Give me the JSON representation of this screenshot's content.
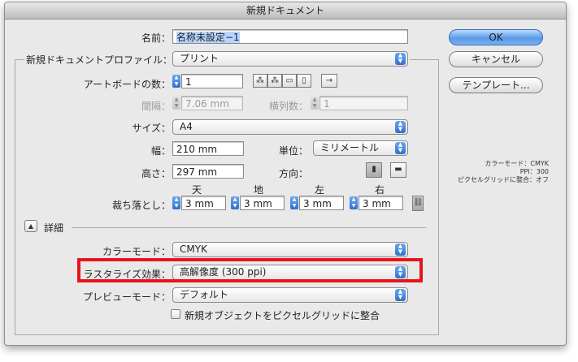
{
  "window": {
    "title": "新規ドキュメント"
  },
  "name": {
    "label": "名前：",
    "value": "名称未設定−1"
  },
  "profile": {
    "label": "新規ドキュメントプロファイル：",
    "value": "プリント"
  },
  "artboards": {
    "label": "アートボードの数：",
    "value": "1"
  },
  "spacing": {
    "label": "間隔：",
    "value": "7.06 mm"
  },
  "columns": {
    "label": "横列数：",
    "value": "1"
  },
  "size": {
    "label": "サイズ：",
    "value": "A4"
  },
  "width": {
    "label": "幅：",
    "value": "210 mm"
  },
  "units": {
    "label": "単位：",
    "value": "ミリメートル"
  },
  "height": {
    "label": "高さ：",
    "value": "297 mm"
  },
  "orientation": {
    "label": "方向："
  },
  "bleed": {
    "label": "裁ち落とし：",
    "top": {
      "label": "天",
      "value": "3 mm"
    },
    "bottom": {
      "label": "地",
      "value": "3 mm"
    },
    "left": {
      "label": "左",
      "value": "3 mm"
    },
    "right": {
      "label": "右",
      "value": "3 mm"
    }
  },
  "advanced": {
    "label": "詳細"
  },
  "color_mode": {
    "label": "カラーモード：",
    "value": "CMYK"
  },
  "raster": {
    "label": "ラスタライズ効果：",
    "value": "高解像度 (300 ppi)"
  },
  "preview": {
    "label": "プレビューモード：",
    "value": "デフォルト"
  },
  "pixel_grid": {
    "label": "新規オブジェクトをピクセルグリッドに整合"
  },
  "buttons": {
    "ok": "OK",
    "cancel": "キャンセル",
    "templates": "テンプレート..."
  },
  "summary": {
    "line1": "カラーモード：CMYK",
    "line2": "PPI：300",
    "line3": "ピクセルグリッドに整合：オフ"
  },
  "colors": {
    "highlight": "#e8141c",
    "accent": "#2f6fd0"
  }
}
